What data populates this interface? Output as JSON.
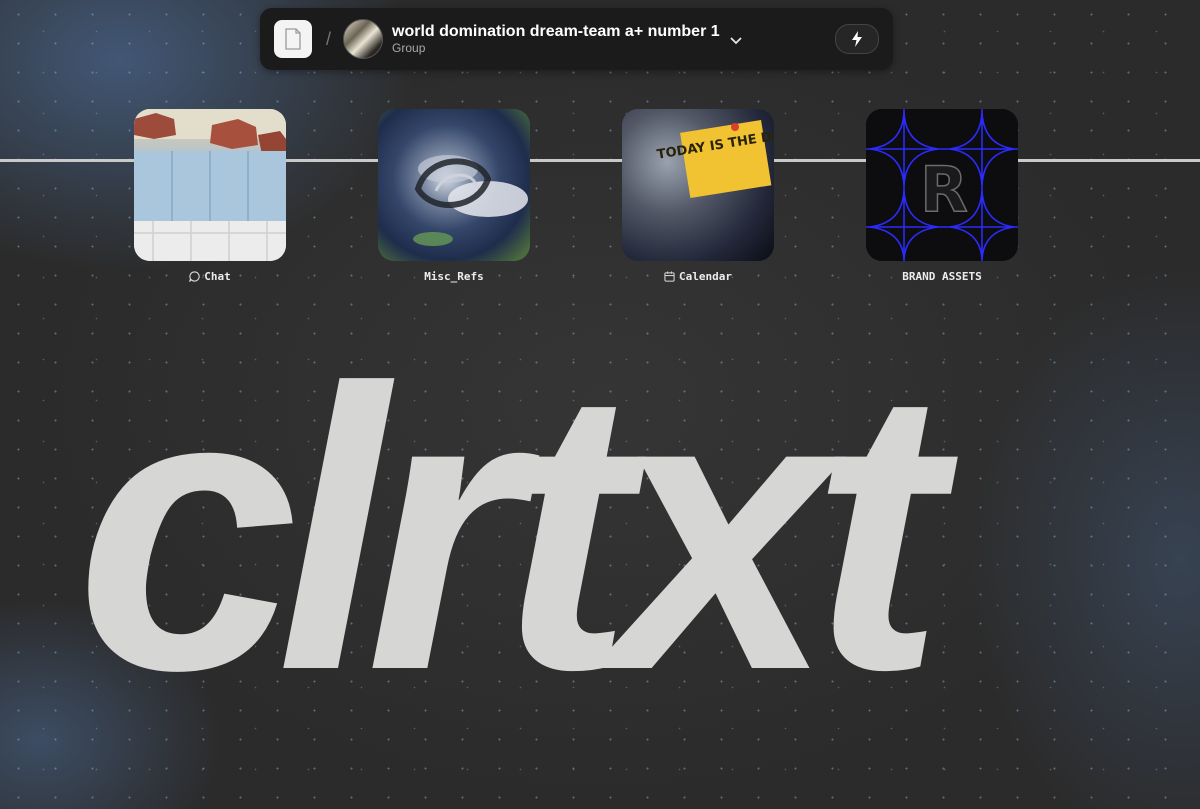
{
  "header": {
    "group_title": "world domination dream-team a+ number 1",
    "group_type": "Group",
    "separator": "/"
  },
  "tiles": [
    {
      "label": "Chat",
      "icon": "chat-bubble-icon"
    },
    {
      "label": "Misc_Refs",
      "icon": ""
    },
    {
      "label": "Calendar",
      "icon": "calendar-icon"
    },
    {
      "label": "BRAND ASSETS",
      "icon": ""
    }
  ],
  "thumbnails": {
    "calendar_note": "TODAY IS THE DAY",
    "brand_letter": "R"
  },
  "wordmark": "clrtxt",
  "colors": {
    "background": "#2f2f2f",
    "topbar": "#1b1b1b",
    "wordmark": "#d6d6d4",
    "rail": "#c9c9c9",
    "brand_grid": "#2b2bff"
  }
}
